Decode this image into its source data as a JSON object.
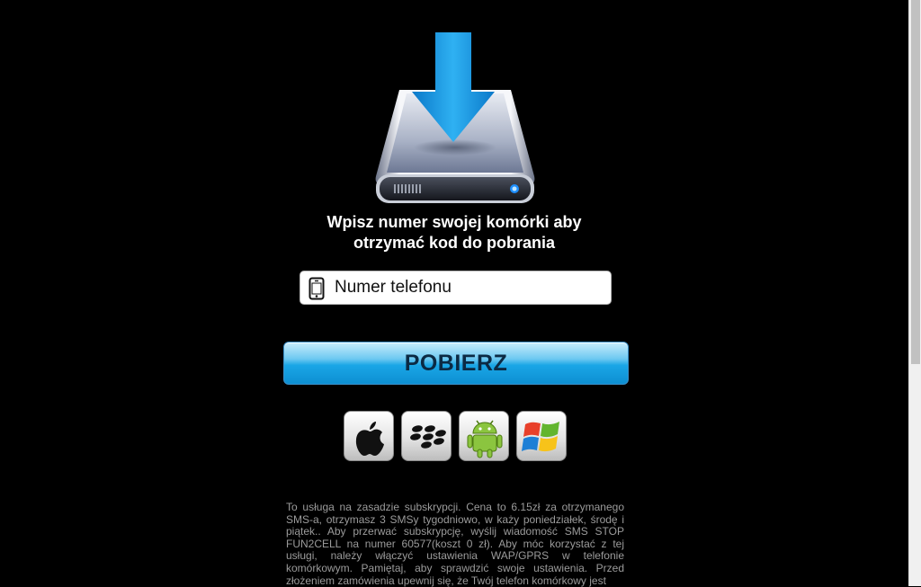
{
  "headline": {
    "line1": "Wpisz numer swojej komórki aby",
    "line2": "otrzymać kod do pobrania"
  },
  "phone_field": {
    "placeholder": "Numer telefonu",
    "icon": "smartphone-icon"
  },
  "submit_button": {
    "label": "POBIERZ"
  },
  "platforms": [
    {
      "name": "Apple",
      "icon": "apple-icon"
    },
    {
      "name": "BlackBerry",
      "icon": "blackberry-icon"
    },
    {
      "name": "Android",
      "icon": "android-icon"
    },
    {
      "name": "Windows",
      "icon": "windows-icon"
    }
  ],
  "terms_text": "To usługa na zasadzie subskrypcji. Cena to 6.15zł za otrzymanego SMS-a, otrzymasz 3 SMSy tygodniowo, w każy poniedziałek, środę i piątek.. Aby przerwać subskrypcję, wyślij wiadomość SMS STOP FUN2CELL na numer 60577(koszt 0 zł). Aby móc korzystać z tej usługi, należy włączyć ustawienia WAP/GPRS w telefonie komórkowym. Pamiętaj, aby sprawdzić swoje ustawienia. Przed złożeniem zamówienia upewnij się, że Twój telefon komórkowy jest",
  "colors": {
    "background": "#000000",
    "button_blue": "#1aa6e6",
    "arrow_blue": "#1c9de6",
    "terms_gray": "#9b9b9b"
  }
}
